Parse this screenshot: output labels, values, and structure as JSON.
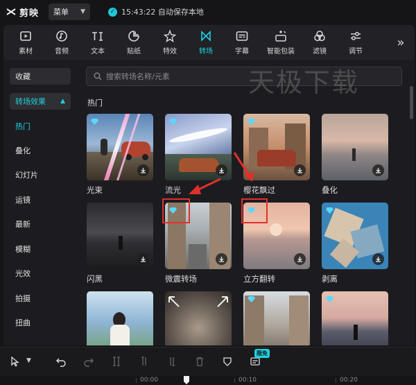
{
  "app": {
    "name": "剪映",
    "menu_label": "菜单",
    "save_status": "15:43:22 自动保存本地"
  },
  "toolbar": {
    "items": [
      {
        "label": "素材",
        "icon": "play-square-icon"
      },
      {
        "label": "音频",
        "icon": "music-note-icon"
      },
      {
        "label": "文本",
        "icon": "text-ti-icon"
      },
      {
        "label": "贴纸",
        "icon": "sticker-icon"
      },
      {
        "label": "特效",
        "icon": "sparkle-star-icon"
      },
      {
        "label": "转场",
        "icon": "transition-bowtie-icon"
      },
      {
        "label": "字幕",
        "icon": "subtitle-icon"
      },
      {
        "label": "智能包装",
        "icon": "magic-wand-icon"
      },
      {
        "label": "滤镜",
        "icon": "filter-circles-icon"
      },
      {
        "label": "调节",
        "icon": "sliders-icon"
      }
    ],
    "active": "转场",
    "accent": "#1fd1e0"
  },
  "sidebar": {
    "favorites": "收藏",
    "group": "转场效果",
    "categories": [
      "热门",
      "叠化",
      "幻灯片",
      "运镜",
      "最新",
      "模糊",
      "光效",
      "拍摄",
      "扭曲"
    ],
    "active_category": "热门"
  },
  "search": {
    "placeholder": "搜索转场名称/元素"
  },
  "watermark": "天极下载",
  "section_title": "热门",
  "cards": [
    {
      "name": "光束",
      "vip": true
    },
    {
      "name": "流光",
      "vip": true
    },
    {
      "name": "樱花飘过",
      "vip": true
    },
    {
      "name": "叠化",
      "vip": false
    },
    {
      "name": "闪黑",
      "vip": false
    },
    {
      "name": "微震转场",
      "vip": true
    },
    {
      "name": "立方翻转",
      "vip": true
    },
    {
      "name": "剥离",
      "vip": true
    },
    {
      "name": "",
      "vip": false
    },
    {
      "name": "",
      "vip": false
    },
    {
      "name": "",
      "vip": true
    },
    {
      "name": "",
      "vip": true
    }
  ],
  "bottom": {
    "badge": "限免",
    "timecodes": [
      "00:00",
      "00:10",
      "00:20"
    ]
  }
}
